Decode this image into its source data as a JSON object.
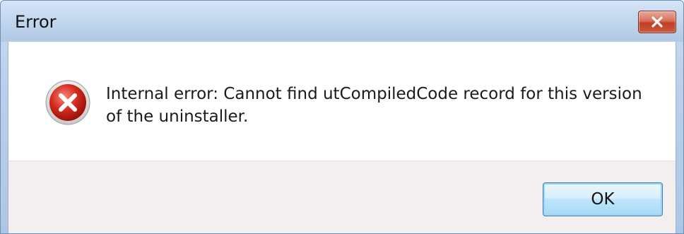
{
  "window": {
    "title": "Error"
  },
  "titlebar": {
    "close_icon": "close-icon"
  },
  "dialog": {
    "icon": "error-icon",
    "message": "Internal error: Cannot find utCompiledCode record for this version of the uninstaller."
  },
  "buttons": {
    "ok_label": "OK"
  },
  "colors": {
    "title_bar": "#c3d7ef",
    "close_button": "#c13e23",
    "error_red": "#d42a1e",
    "footer": "#f3eff1",
    "ok_button_border": "#3c7fb1"
  }
}
